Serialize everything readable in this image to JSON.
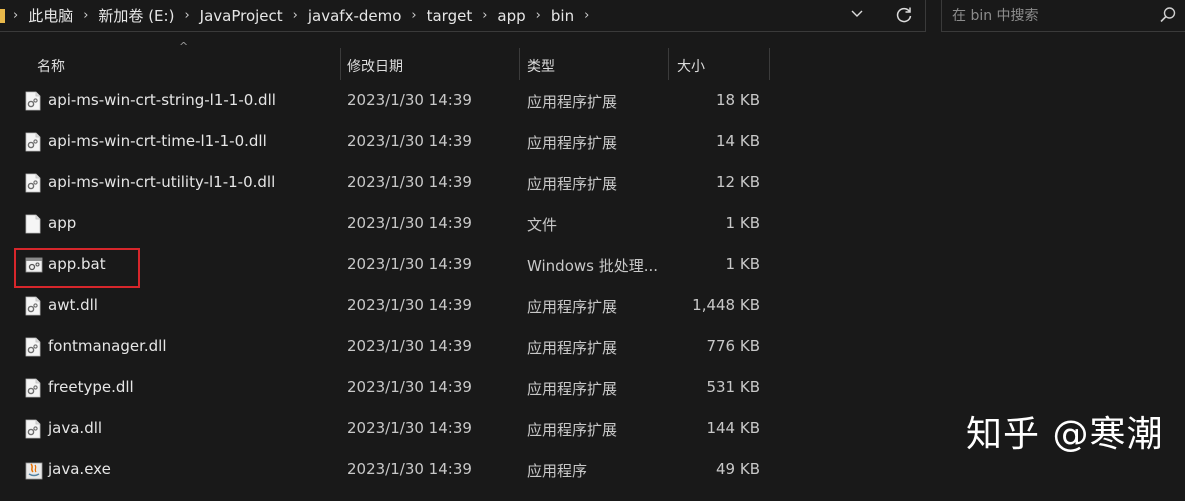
{
  "breadcrumb": [
    "此电脑",
    "新加卷 (E:)",
    "JavaProject",
    "javafx-demo",
    "target",
    "app",
    "bin"
  ],
  "search": {
    "placeholder": "在 bin 中搜索"
  },
  "columns": {
    "name": "名称",
    "date": "修改日期",
    "type": "类型",
    "size": "大小"
  },
  "files": [
    {
      "name": "api-ms-win-crt-string-l1-1-0.dll",
      "date": "2023/1/30 14:39",
      "type": "应用程序扩展",
      "size": "18 KB",
      "icon": "dll-file-icon"
    },
    {
      "name": "api-ms-win-crt-time-l1-1-0.dll",
      "date": "2023/1/30 14:39",
      "type": "应用程序扩展",
      "size": "14 KB",
      "icon": "dll-file-icon"
    },
    {
      "name": "api-ms-win-crt-utility-l1-1-0.dll",
      "date": "2023/1/30 14:39",
      "type": "应用程序扩展",
      "size": "12 KB",
      "icon": "dll-file-icon"
    },
    {
      "name": "app",
      "date": "2023/1/30 14:39",
      "type": "文件",
      "size": "1 KB",
      "icon": "blank-file-icon"
    },
    {
      "name": "app.bat",
      "date": "2023/1/30 14:39",
      "type": "Windows 批处理...",
      "size": "1 KB",
      "icon": "batch-file-icon"
    },
    {
      "name": "awt.dll",
      "date": "2023/1/30 14:39",
      "type": "应用程序扩展",
      "size": "1,448 KB",
      "icon": "dll-file-icon"
    },
    {
      "name": "fontmanager.dll",
      "date": "2023/1/30 14:39",
      "type": "应用程序扩展",
      "size": "776 KB",
      "icon": "dll-file-icon"
    },
    {
      "name": "freetype.dll",
      "date": "2023/1/30 14:39",
      "type": "应用程序扩展",
      "size": "531 KB",
      "icon": "dll-file-icon"
    },
    {
      "name": "java.dll",
      "date": "2023/1/30 14:39",
      "type": "应用程序扩展",
      "size": "144 KB",
      "icon": "dll-file-icon"
    },
    {
      "name": "java.exe",
      "date": "2023/1/30 14:39",
      "type": "应用程序",
      "size": "49 KB",
      "icon": "java-exe-icon"
    }
  ],
  "watermark": "知乎 @寒潮",
  "colors": {
    "background": "#191919",
    "highlight_border": "#d7262b",
    "text": "#e6e6e6"
  }
}
